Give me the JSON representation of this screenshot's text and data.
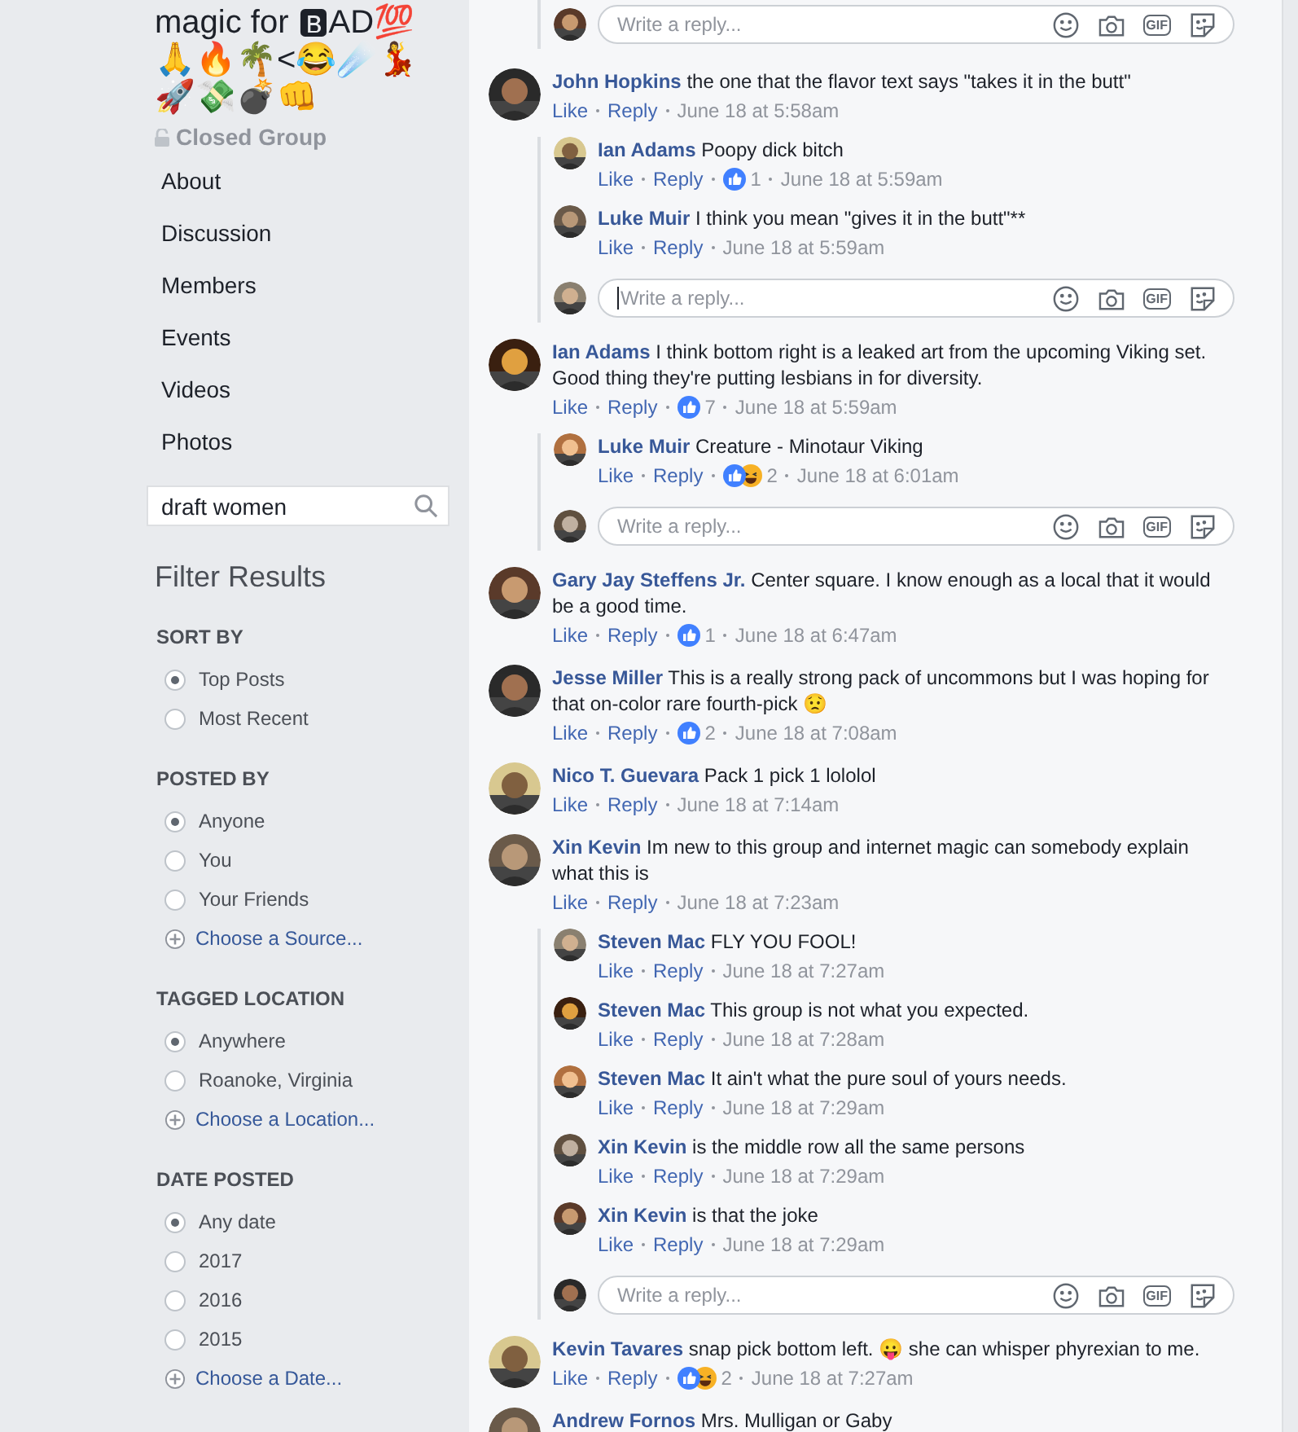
{
  "sidebar": {
    "group_title": "magic for 🅱AD💯🙏🔥🌴<😂☄️💃🚀💸💣👊",
    "privacy": "Closed Group",
    "nav": [
      {
        "label": "About"
      },
      {
        "label": "Discussion"
      },
      {
        "label": "Members"
      },
      {
        "label": "Events"
      },
      {
        "label": "Videos"
      },
      {
        "label": "Photos"
      }
    ],
    "search": {
      "value": "draft women"
    },
    "filter_title": "Filter Results",
    "sections": [
      {
        "title": "SORT BY",
        "options": [
          {
            "label": "Top Posts",
            "selected": true
          },
          {
            "label": "Most Recent",
            "selected": false
          }
        ]
      },
      {
        "title": "POSTED BY",
        "options": [
          {
            "label": "Anyone",
            "selected": true
          },
          {
            "label": "You",
            "selected": false
          },
          {
            "label": "Your Friends",
            "selected": false
          }
        ],
        "link": "Choose a Source..."
      },
      {
        "title": "TAGGED LOCATION",
        "options": [
          {
            "label": "Anywhere",
            "selected": true
          },
          {
            "label": "Roanoke, Virginia",
            "selected": false
          }
        ],
        "link": "Choose a Location..."
      },
      {
        "title": "DATE POSTED",
        "options": [
          {
            "label": "Any date",
            "selected": true
          },
          {
            "label": "2017",
            "selected": false
          },
          {
            "label": "2016",
            "selected": false
          },
          {
            "label": "2015",
            "selected": false
          }
        ],
        "link": "Choose a Date..."
      }
    ]
  },
  "thread": [
    {
      "kind": "reply_box",
      "placeholder": "Write a reply...",
      "gif": "GIF",
      "focused": false
    },
    {
      "kind": "comment",
      "author": "John Hopkins",
      "text": "the one that the flavor text says \"takes it in the butt\"",
      "like": "Like",
      "reply": "Reply",
      "time": "June 18 at 5:58am",
      "replies": [
        {
          "author": "Ian Adams",
          "text": "Poopy dick bitch",
          "like": "Like",
          "reply": "Reply",
          "reactions": [
            {
              "kind": "like"
            }
          ],
          "count": "1",
          "time": "June 18 at 5:59am"
        },
        {
          "author": "Luke Muir",
          "text": "I think you mean \"gives it in the butt\"**",
          "like": "Like",
          "reply": "Reply",
          "time": "June 18 at 5:59am"
        }
      ],
      "reply_box": {
        "placeholder": "Write a reply...",
        "gif": "GIF",
        "focused": true
      }
    },
    {
      "kind": "comment",
      "author": "Ian Adams",
      "text": "I think bottom right is a leaked art from the upcoming Viking set. Good thing they're putting lesbians in for diversity.",
      "like": "Like",
      "reply": "Reply",
      "reactions": [
        {
          "kind": "like"
        }
      ],
      "count": "7",
      "time": "June 18 at 5:59am",
      "replies": [
        {
          "author": "Luke Muir",
          "text": "Creature - Minotaur Viking",
          "like": "Like",
          "reply": "Reply",
          "reactions": [
            {
              "kind": "like"
            },
            {
              "kind": "haha"
            }
          ],
          "count": "2",
          "time": "June 18 at 6:01am"
        }
      ],
      "reply_box": {
        "placeholder": "Write a reply...",
        "gif": "GIF",
        "focused": false
      }
    },
    {
      "kind": "comment",
      "author": "Gary Jay Steffens Jr.",
      "text": "Center square. I know enough as a local that it would be a good time.",
      "like": "Like",
      "reply": "Reply",
      "reactions": [
        {
          "kind": "like"
        }
      ],
      "count": "1",
      "time": "June 18 at 6:47am"
    },
    {
      "kind": "comment",
      "author": "Jesse Miller",
      "text": "This is a really strong pack of uncommons but I was hoping for that on-color rare fourth-pick 😟",
      "like": "Like",
      "reply": "Reply",
      "reactions": [
        {
          "kind": "like"
        }
      ],
      "count": "2",
      "time": "June 18 at 7:08am"
    },
    {
      "kind": "comment",
      "author": "Nico T. Guevara",
      "text": "Pack 1 pick 1 lololol",
      "like": "Like",
      "reply": "Reply",
      "time": "June 18 at 7:14am"
    },
    {
      "kind": "comment",
      "author": "Xin Kevin",
      "text": "Im new to this group and internet magic can somebody explain what this is",
      "like": "Like",
      "reply": "Reply",
      "time": "June 18 at 7:23am",
      "replies": [
        {
          "author": "Steven Mac",
          "text": "FLY YOU FOOL!",
          "like": "Like",
          "reply": "Reply",
          "time": "June 18 at 7:27am"
        },
        {
          "author": "Steven Mac",
          "text": "This group is not what you expected.",
          "like": "Like",
          "reply": "Reply",
          "time": "June 18 at 7:28am"
        },
        {
          "author": "Steven Mac",
          "text": "It ain't what the pure soul of yours needs.",
          "like": "Like",
          "reply": "Reply",
          "time": "June 18 at 7:29am"
        },
        {
          "author": "Xin Kevin",
          "text": "is the middle row all the same persons",
          "like": "Like",
          "reply": "Reply",
          "time": "June 18 at 7:29am"
        },
        {
          "author": "Xin Kevin",
          "text": "is that the joke",
          "like": "Like",
          "reply": "Reply",
          "time": "June 18 at 7:29am"
        }
      ],
      "reply_box": {
        "placeholder": "Write a reply...",
        "gif": "GIF",
        "focused": false
      }
    },
    {
      "kind": "comment",
      "author": "Kevin Tavares",
      "text": "snap pick bottom left. 😛 she can whisper phyrexian to me.",
      "like": "Like",
      "reply": "Reply",
      "reactions": [
        {
          "kind": "like"
        },
        {
          "kind": "haha"
        }
      ],
      "count": "2",
      "time": "June 18 at 7:27am"
    },
    {
      "kind": "comment",
      "author": "Andrew Fornos",
      "text": "Mrs. Mulligan or Gaby"
    }
  ]
}
